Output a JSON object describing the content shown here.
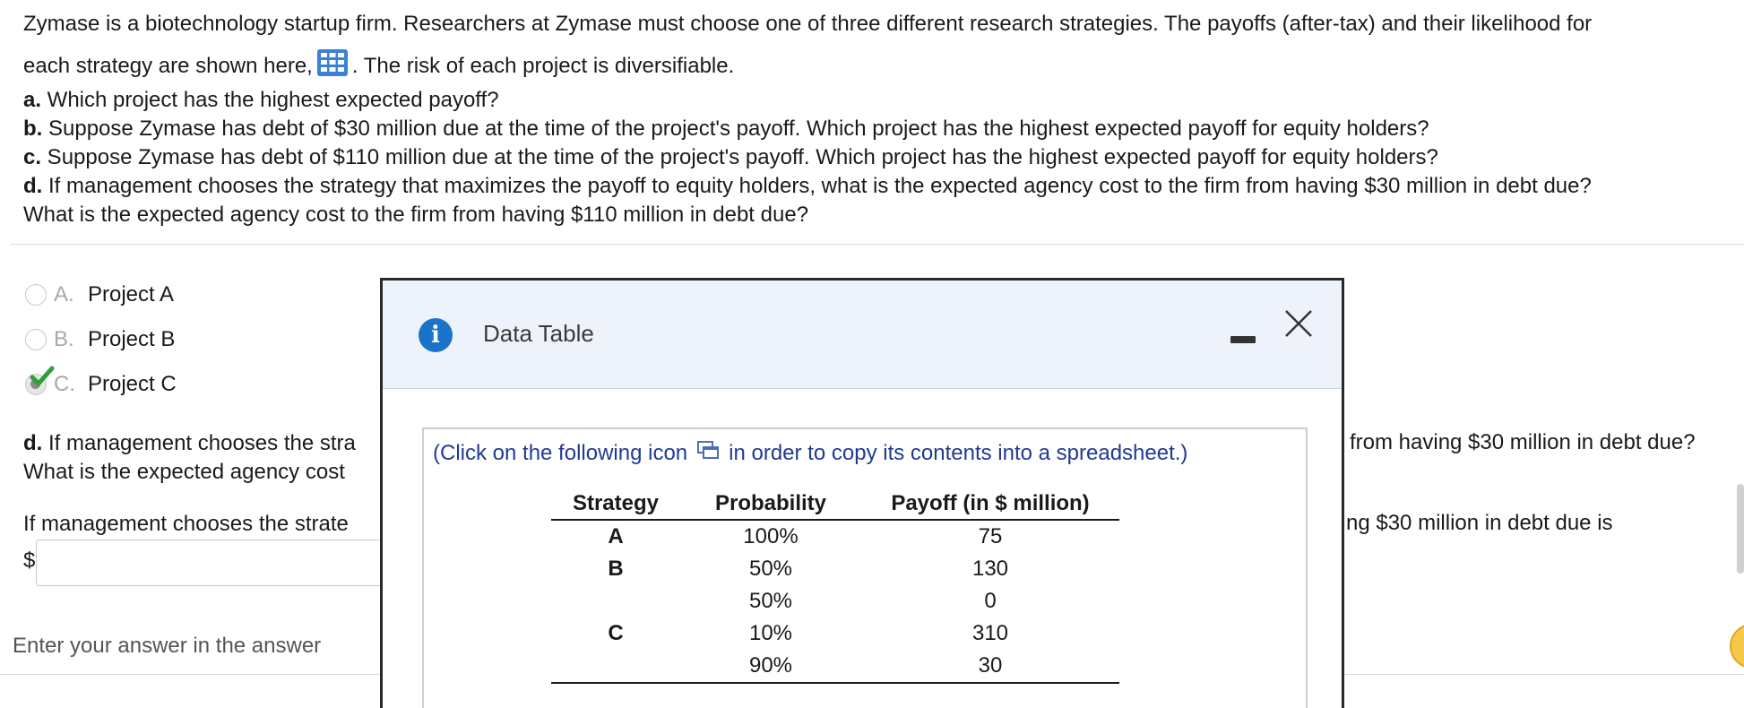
{
  "question": {
    "line1": "Zymase is a biotechnology startup firm. Researchers at Zymase must choose one of three different research strategies. The payoffs (after-tax) and their likelihood for",
    "line2_before": "each strategy are shown here,",
    "line2_after": ". The risk of each project is diversifiable.",
    "parts": [
      {
        "label": "a.",
        "text": " Which project has the highest expected payoff?"
      },
      {
        "label": "b.",
        "text": " Suppose Zymase has debt of $30 million due at the time of the project's payoff. Which project has the highest expected payoff for equity holders?"
      },
      {
        "label": "c.",
        "text": " Suppose Zymase has debt of $110 million due at the time of the project's payoff. Which project has the highest expected payoff for equity holders?"
      },
      {
        "label": "d.",
        "text": " If management chooses the strategy that maximizes the payoff to equity holders, what is the expected agency cost to the firm from having $30 million in debt due?"
      }
    ],
    "part_d_line2": "What is the expected agency cost to the firm from having $110 million in debt due?"
  },
  "options": [
    {
      "letter": "A.",
      "text": "Project A",
      "selected": false
    },
    {
      "letter": "B.",
      "text": "Project B",
      "selected": false
    },
    {
      "letter": "C.",
      "text": "Project C",
      "selected": true
    }
  ],
  "part_d": {
    "label": "d.",
    "text_left": " If management chooses the stra",
    "line2_left": "What is the expected agency cost",
    "text_right": "from having $30 million in debt due?",
    "answer_left": "If management chooses the strate",
    "answer_right": "ng $30 million in debt due is",
    "currency": "$",
    "answer_value": ""
  },
  "bottom_hint": "Enter your answer in the answer",
  "modal": {
    "title": "Data Table",
    "instruction_before": "(Click on the following icon",
    "instruction_after": "in order to copy its contents into a spreadsheet.)",
    "columns": [
      "Strategy",
      "Probability",
      "Payoff (in $ million)"
    ],
    "rows": [
      {
        "strategy": "A",
        "probability": "100%",
        "payoff": "75"
      },
      {
        "strategy": "B",
        "probability": "50%",
        "payoff": "130"
      },
      {
        "strategy": "",
        "probability": "50%",
        "payoff": "0"
      },
      {
        "strategy": "C",
        "probability": "10%",
        "payoff": "310"
      },
      {
        "strategy": "",
        "probability": "90%",
        "payoff": "30"
      }
    ]
  },
  "colors": {
    "accent_blue": "#1a73c9",
    "instruction_blue": "#1f3a93",
    "check_green": "#2e9e3a",
    "modal_header_bg": "#eef3fb"
  }
}
